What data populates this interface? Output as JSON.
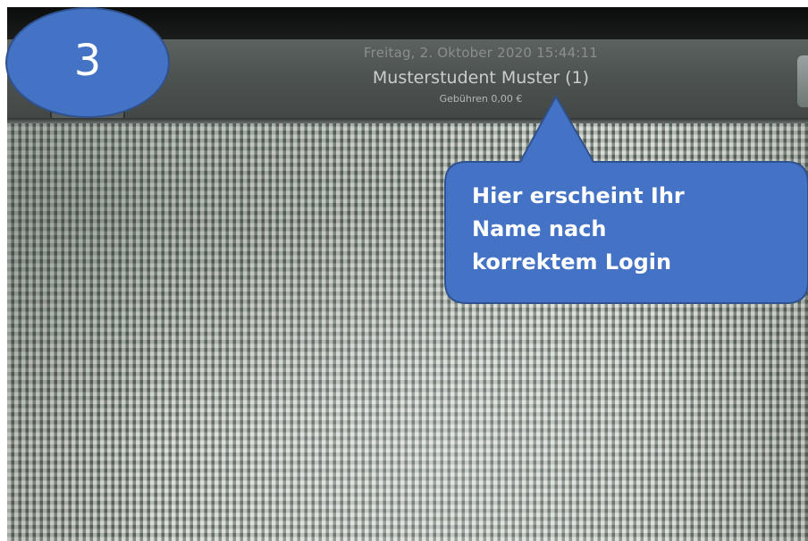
{
  "kiosk": {
    "datetime": "Freitag, 2. Oktober 2020 15:44:11",
    "user_name": "Musterstudent Muster (1)",
    "fees": "Gebühren 0,00 €"
  },
  "annotation": {
    "step_number": "3",
    "callout_lines": [
      "Hier erscheint Ihr",
      "Name nach",
      "korrektem Login"
    ]
  },
  "colors": {
    "badge_fill": "#4472c4",
    "badge_border": "#2f528f",
    "callout_fill": "#4472c4",
    "callout_text": "#ffffff"
  }
}
